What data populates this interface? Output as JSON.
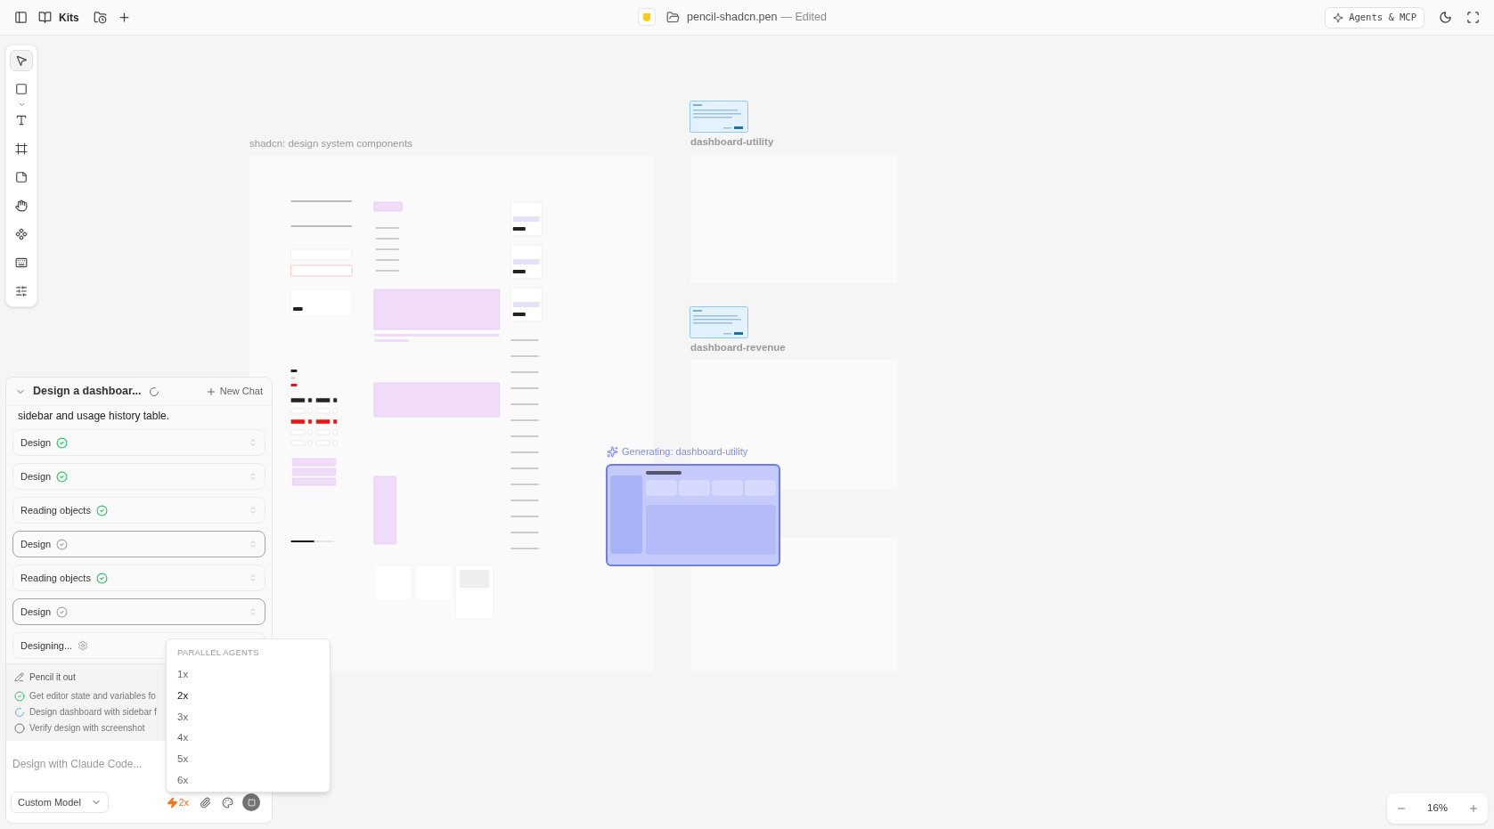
{
  "topbar": {
    "kits_label": "Kits",
    "file_name": "pencil-shadcn.pen",
    "file_state": "— Edited",
    "agents_button": "Agents & MCP"
  },
  "toolbar": {
    "tools": [
      {
        "selected": true
      },
      {
        "selected": false
      },
      {
        "selected": false
      },
      {
        "selected": false
      },
      {
        "selected": false
      },
      {
        "selected": false
      },
      {
        "selected": false
      },
      {
        "selected": false
      },
      {
        "selected": false
      }
    ]
  },
  "canvas": {
    "frames": [
      {
        "kind": "components",
        "label": "shadcn: design system components"
      },
      {
        "kind": "dashboard",
        "label": "dashboard-utility"
      },
      {
        "kind": "dashboard",
        "label": "dashboard-revenue"
      }
    ],
    "generating": {
      "label": "Generating: dashboard-utility"
    }
  },
  "chat": {
    "title": "Design a dashboar...",
    "new_chat": "New Chat",
    "message": "sidebar and usage history table.",
    "steps": [
      {
        "label": "Design",
        "kind": "done"
      },
      {
        "label": "Design",
        "kind": "done"
      },
      {
        "label": "Reading objects",
        "kind": "done"
      },
      {
        "label": "Design",
        "kind": "pending"
      },
      {
        "label": "Reading objects",
        "kind": "done"
      },
      {
        "label": "Design",
        "kind": "pending"
      },
      {
        "label": "Designing...",
        "kind": "running"
      }
    ],
    "plan": {
      "title": "Pencil it out",
      "tasks": [
        {
          "label": "Get editor state and variables fo",
          "kind": "done"
        },
        {
          "label": "Design dashboard with sidebar f",
          "kind": "running"
        },
        {
          "label": "Verify design with screenshot",
          "kind": "todo"
        }
      ]
    },
    "input": {
      "placeholder": "Design with Claude Code..."
    },
    "model": "Custom Model",
    "agents": "2x"
  },
  "agents_menu": {
    "heading": "PARALLEL AGENTS",
    "options": [
      {
        "label": "1x",
        "selected": false
      },
      {
        "label": "2x",
        "selected": true
      },
      {
        "label": "3x",
        "selected": false
      },
      {
        "label": "4x",
        "selected": false
      },
      {
        "label": "5x",
        "selected": false
      },
      {
        "label": "6x",
        "selected": false
      }
    ]
  },
  "zoom": {
    "value": "16%"
  }
}
